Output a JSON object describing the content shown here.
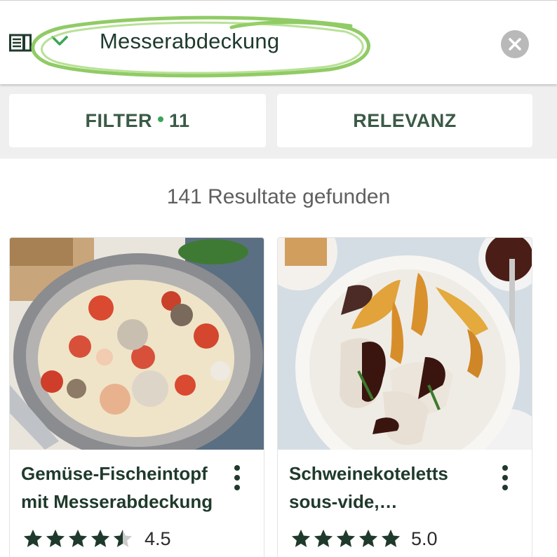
{
  "search": {
    "query": "Messerabdeckung",
    "list_icon": "list-view-icon",
    "chevron_icon": "chevron-down-icon",
    "clear_icon": "clear-icon"
  },
  "filters": {
    "filter_label": "FILTER",
    "filter_count": "11",
    "sort_label": "RELEVANZ"
  },
  "results": {
    "count_text": "141 Resultate gefunden",
    "cards": [
      {
        "title_line1": "Gemüse-Fischeintopf",
        "title_line2": "mit Messerabdeckung",
        "rating": "4.5",
        "rating_value": 4.5,
        "image": "fish-stew-photo"
      },
      {
        "title_line1": "Schweinekoteletts",
        "title_line2": "sous-vide,…",
        "rating": "5.0",
        "rating_value": 5.0,
        "image": "pork-chops-photo"
      }
    ]
  },
  "colors": {
    "brand_green": "#3aa556",
    "text_dark_green": "#1f3a2c",
    "button_text": "#3b5a47",
    "scribble_green": "#7dc24a"
  }
}
